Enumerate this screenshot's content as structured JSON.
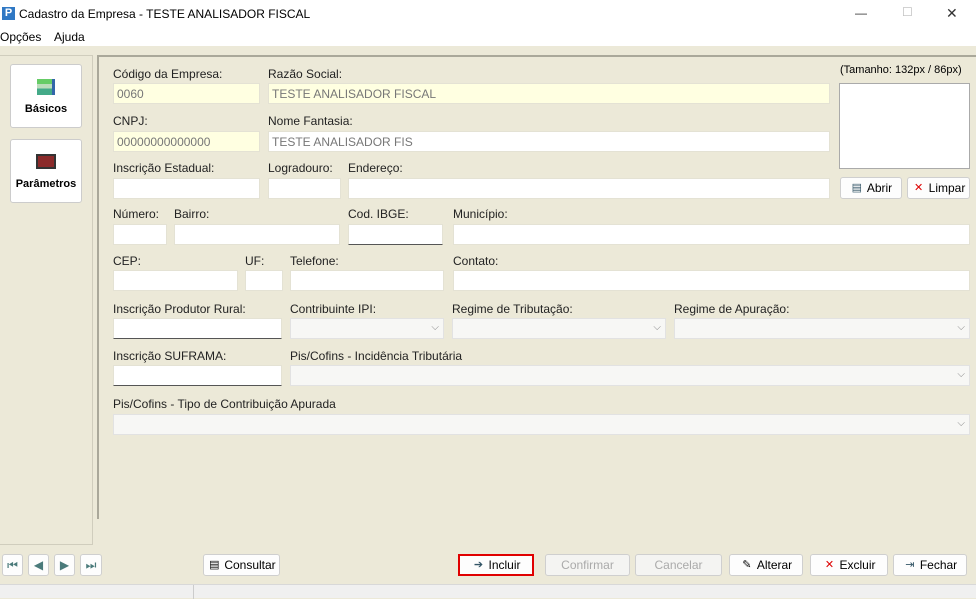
{
  "window": {
    "title": "Cadastro da Empresa - TESTE ANALISADOR FISCAL",
    "minimize": "—",
    "maximize": "☐",
    "close": "✕"
  },
  "menu": [
    "Opções",
    "Ajuda"
  ],
  "sidebar": [
    {
      "label": "Básicos"
    },
    {
      "label": "Parâmetros"
    }
  ],
  "form": {
    "codigo": {
      "label": "Código da Empresa:",
      "value": "0060"
    },
    "razao": {
      "label": "Razão Social:",
      "value": "TESTE ANALISADOR FISCAL"
    },
    "cnpj": {
      "label": "CNPJ:",
      "value": "00000000000000"
    },
    "fantasia": {
      "label": "Nome Fantasia:",
      "value": "TESTE ANALISADOR FIS"
    },
    "ie": {
      "label": "Inscrição Estadual:"
    },
    "logradouro": {
      "label": "Logradouro:"
    },
    "endereco": {
      "label": "Endereço:"
    },
    "numero": {
      "label": "Número:"
    },
    "bairro": {
      "label": "Bairro:"
    },
    "ibge": {
      "label": "Cod. IBGE:"
    },
    "municipio": {
      "label": "Município:"
    },
    "cep": {
      "label": "CEP:"
    },
    "uf": {
      "label": "UF:"
    },
    "telefone": {
      "label": "Telefone:"
    },
    "contato": {
      "label": "Contato:"
    },
    "produtor": {
      "label": "Inscrição Produtor Rural:"
    },
    "ipi": {
      "label": "Contribuinte IPI:"
    },
    "regime_trib": {
      "label": "Regime de Tributação:"
    },
    "regime_apur": {
      "label": "Regime de Apuração:"
    },
    "suframa": {
      "label": "Inscrição SUFRAMA:"
    },
    "pis_incid": {
      "label": "Pis/Cofins - Incidência Tributária"
    },
    "pis_tipo": {
      "label": "Pis/Cofins - Tipo de Contribuição Apurada"
    }
  },
  "image": {
    "size_label": "(Tamanho: 132px / 86px)",
    "open": "Abrir",
    "clear": "Limpar"
  },
  "toolbar": {
    "consultar": "Consultar",
    "incluir": "Incluir",
    "confirmar": "Confirmar",
    "cancelar": "Cancelar",
    "alterar": "Alterar",
    "excluir": "Excluir",
    "fechar": "Fechar"
  },
  "colors": {
    "highlight": "#e00000",
    "readonly": "#ffffe1",
    "background": "#ece9d8"
  }
}
